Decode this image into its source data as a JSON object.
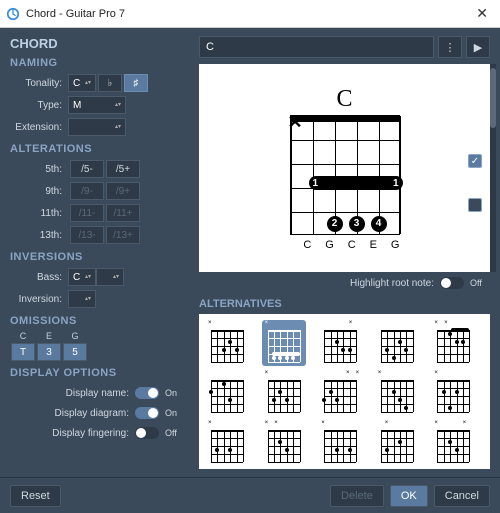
{
  "window": {
    "title": "Chord - Guitar Pro 7"
  },
  "headers": {
    "main": "CHORD",
    "naming": "NAMING",
    "alterations": "ALTERATIONS",
    "inversions": "INVERSIONS",
    "omissions": "OMISSIONS",
    "display": "DISPLAY OPTIONS",
    "alternatives": "ALTERNATIVES"
  },
  "naming": {
    "tonality_label": "Tonality:",
    "tonality_value": "C",
    "flat": "♭",
    "sharp": "♯",
    "type_label": "Type:",
    "type_value": "M",
    "extension_label": "Extension:",
    "extension_value": ""
  },
  "alterations": {
    "r5_label": "5th:",
    "r5_minus": "/5-",
    "r5_plus": "/5+",
    "r9_label": "9th:",
    "r9_minus": "/9-",
    "r9_plus": "/9+",
    "r11_label": "11th:",
    "r11_minus": "/11-",
    "r11_plus": "/11+",
    "r13_label": "13th:",
    "r13_minus": "/13-",
    "r13_plus": "/13+"
  },
  "inversions": {
    "bass_label": "Bass:",
    "bass_value": "C",
    "inv_label": "Inversion:",
    "inv_value": ""
  },
  "omissions": {
    "cols": [
      "C",
      "E",
      "G"
    ],
    "vals": [
      "T",
      "3",
      "5"
    ]
  },
  "display": {
    "name_label": "Display name:",
    "name_on": true,
    "diagram_label": "Display diagram:",
    "diagram_on": true,
    "fingering_label": "Display fingering:",
    "fingering_on": false
  },
  "chord": {
    "name": "C",
    "diagram_title": "C",
    "notes": [
      "",
      "C",
      "G",
      "C",
      "E",
      "G"
    ],
    "highlight_label": "Highlight root note:",
    "highlight_on": false
  },
  "state": {
    "on": "On",
    "off": "Off",
    "more": "⋮",
    "play": "▶"
  },
  "footer": {
    "reset": "Reset",
    "delete": "Delete",
    "ok": "OK",
    "cancel": "Cancel"
  }
}
